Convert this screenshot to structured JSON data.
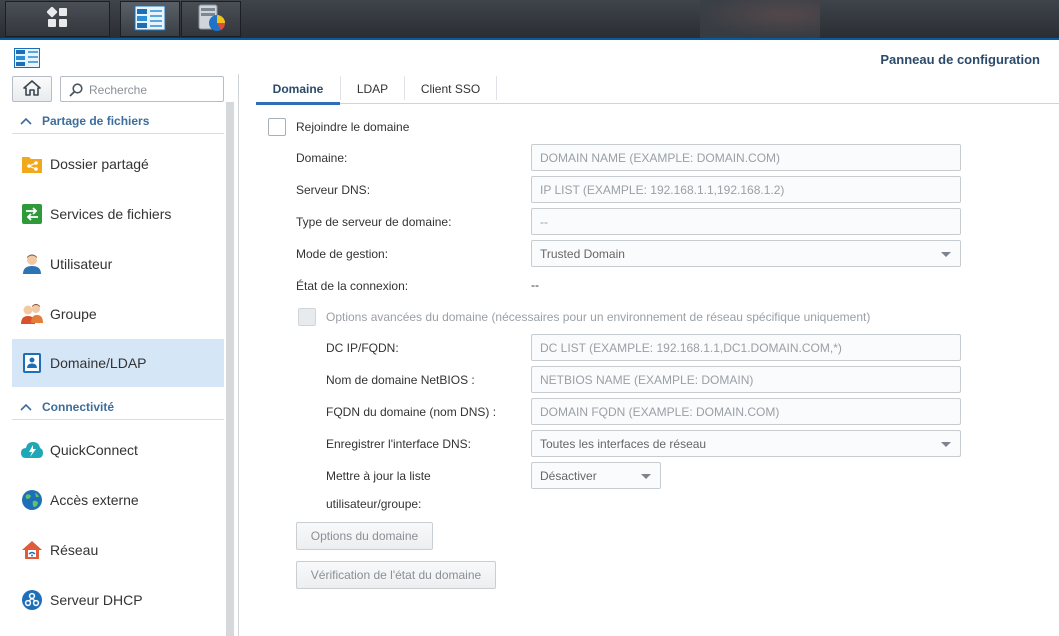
{
  "taskbar": {
    "main_menu_icon": "main-menu-grid-icon",
    "app1_icon": "control-panel-icon",
    "app2_icon": "storage-manager-icon"
  },
  "window": {
    "title": "Panneau de configuration",
    "icon": "control-panel-icon"
  },
  "sidebar": {
    "home_icon": "home-icon",
    "search": {
      "placeholder": "Recherche",
      "icon": "search-icon"
    },
    "categories": [
      {
        "label": "Partage de fichiers"
      },
      {
        "label": "Connectivité"
      }
    ],
    "items": [
      {
        "label": "Dossier partagé",
        "icon": "shared-folder-icon"
      },
      {
        "label": "Services de fichiers",
        "icon": "file-services-icon"
      },
      {
        "label": "Utilisateur",
        "icon": "user-icon"
      },
      {
        "label": "Groupe",
        "icon": "group-icon"
      },
      {
        "label": "Domaine/LDAP",
        "icon": "domain-ldap-icon",
        "active": true
      },
      {
        "label": "QuickConnect",
        "icon": "quickconnect-icon"
      },
      {
        "label": "Accès externe",
        "icon": "external-access-icon"
      },
      {
        "label": "Réseau",
        "icon": "network-icon"
      },
      {
        "label": "Serveur DHCP",
        "icon": "dhcp-server-icon"
      }
    ]
  },
  "tabs": [
    {
      "label": "Domaine",
      "active": true
    },
    {
      "label": "LDAP"
    },
    {
      "label": "Client SSO"
    }
  ],
  "form": {
    "join_domain_label": "Rejoindre le domaine",
    "domain": {
      "label": "Domaine:",
      "placeholder": "DOMAIN NAME (EXAMPLE: DOMAIN.COM)"
    },
    "dns_server": {
      "label": "Serveur DNS:",
      "placeholder": "IP LIST (EXAMPLE: 192.168.1.1,192.168.1.2)"
    },
    "domain_server_type": {
      "label": "Type de serveur de domaine:",
      "value": "--"
    },
    "management_mode": {
      "label": "Mode de gestion:",
      "value": "Trusted Domain"
    },
    "connection_state": {
      "label": "État de la connexion:",
      "value": "--"
    },
    "advanced_options_label": "Options avancées du domaine (nécessaires pour un environnement de réseau spécifique uniquement)",
    "dc_ip": {
      "label": "DC IP/FQDN:",
      "placeholder": "DC LIST (EXAMPLE: 192.168.1.1,DC1.DOMAIN.COM,*)"
    },
    "netbios": {
      "label": "Nom de domaine NetBIOS :",
      "placeholder": "NETBIOS NAME (EXAMPLE: DOMAIN)"
    },
    "fqdn": {
      "label": "FQDN du domaine (nom DNS) :",
      "placeholder": "DOMAIN FQDN (EXAMPLE: DOMAIN.COM)"
    },
    "dns_interface": {
      "label": "Enregistrer l'interface DNS:",
      "value": "Toutes les interfaces de réseau"
    },
    "update_list": {
      "label_line1": "Mettre à jour la liste",
      "label_line2": "utilisateur/groupe:",
      "value": "Désactiver"
    },
    "domain_options_button": "Options du domaine",
    "check_status_button": "Vérification de l'état du domaine"
  }
}
